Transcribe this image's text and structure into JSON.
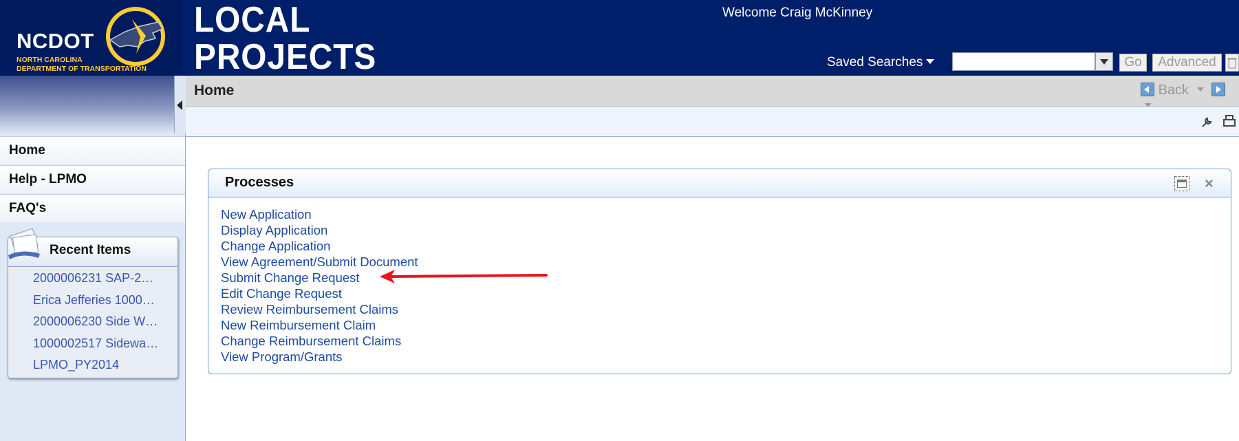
{
  "header": {
    "logo_text": "NCDOT",
    "logo_subline1": "NORTH CAROLINA",
    "logo_subline2": "DEPARTMENT OF TRANSPORTATION",
    "app_title_line1": "LOCAL",
    "app_title_line2": "PROJECTS",
    "welcome": "Welcome Craig McKinney",
    "saved_searches_label": "Saved Searches",
    "search_value": "",
    "go_label": "Go",
    "advanced_label": "Advanced"
  },
  "nav": {
    "items": [
      {
        "label": "Home"
      },
      {
        "label": "Help - LPMO"
      },
      {
        "label": "FAQ's"
      }
    ]
  },
  "recent": {
    "title": "Recent Items",
    "items": [
      {
        "label": "2000006231 SAP-2…"
      },
      {
        "label": "Erica Jefferies 1000…"
      },
      {
        "label": "2000006230 Side W…"
      },
      {
        "label": "1000002517 Sidewa…"
      },
      {
        "label": "LPMO_PY2014"
      }
    ]
  },
  "page": {
    "title": "Home",
    "back_label": "Back"
  },
  "processes": {
    "title": "Processes",
    "links": [
      {
        "label": "New Application"
      },
      {
        "label": "Display Application"
      },
      {
        "label": "Change Application"
      },
      {
        "label": "View Agreement/Submit Document"
      },
      {
        "label": "Submit Change Request"
      },
      {
        "label": "Edit Change Request"
      },
      {
        "label": "Review Reimbursement Claims"
      },
      {
        "label": "New Reimbursement Claim"
      },
      {
        "label": "Change Reimbursement Claims"
      },
      {
        "label": "View Program/Grants"
      }
    ]
  },
  "colors": {
    "header_bg": "#001f6b",
    "link": "#1f4ba0",
    "annotation_arrow": "#e8141c"
  }
}
